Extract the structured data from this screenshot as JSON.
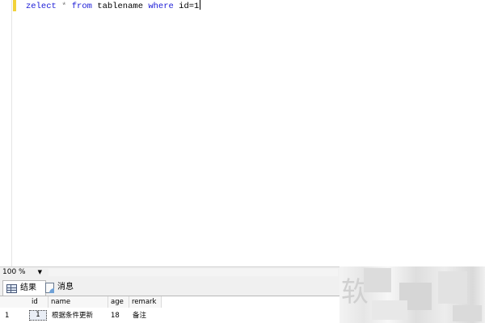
{
  "editor": {
    "tokens": {
      "t1": "zelect",
      "t2": "*",
      "t3": "from",
      "t4": "tablename",
      "t5": "where",
      "t6": "id=1"
    }
  },
  "zoom": {
    "value": "100 %"
  },
  "results": {
    "tabs": [
      {
        "label": "结果"
      },
      {
        "label": "消息"
      }
    ],
    "columns": [
      "id",
      "name",
      "age",
      "remark"
    ],
    "rows": [
      {
        "row_number": "1",
        "id": "1",
        "name": "根据条件更新",
        "age": "18",
        "remark": "备注"
      }
    ]
  },
  "watermark": {
    "char": "软"
  },
  "colors": {
    "keyword": "#1a1ad6",
    "change_marker": "#f2d23a"
  }
}
